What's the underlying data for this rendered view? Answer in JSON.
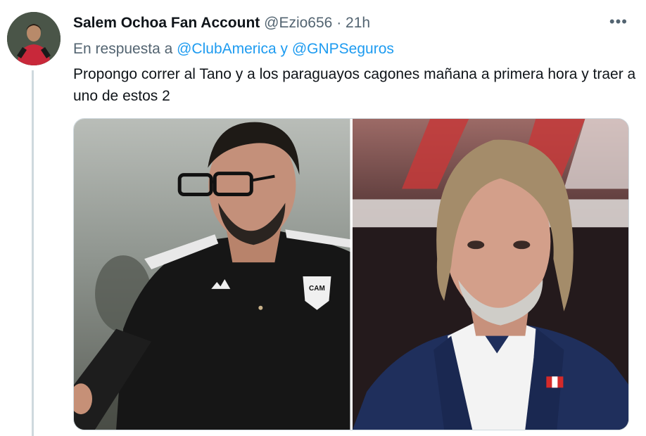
{
  "tweet": {
    "display_name": "Salem Ochoa Fan Account",
    "handle": "@Ezio656",
    "separator": "·",
    "time": "21h",
    "more_icon": "more-horizontal-icon",
    "reply_prefix": "En respuesta a",
    "reply_mention_1": "@ClubAmerica",
    "reply_conjunction": "y",
    "reply_mention_2": "@GNPSeguros",
    "text": "Propongo correr al Tano y a los paraguayos cagones mañana a primera hora y traer a uno de estos 2",
    "colors": {
      "link": "#1d9bf0",
      "secondary_text": "#536471",
      "primary_text": "#0f1419",
      "thread_line": "#cfd9de"
    }
  },
  "media": [
    {
      "type": "photo",
      "badge_text": "CAM"
    },
    {
      "type": "photo"
    }
  ]
}
